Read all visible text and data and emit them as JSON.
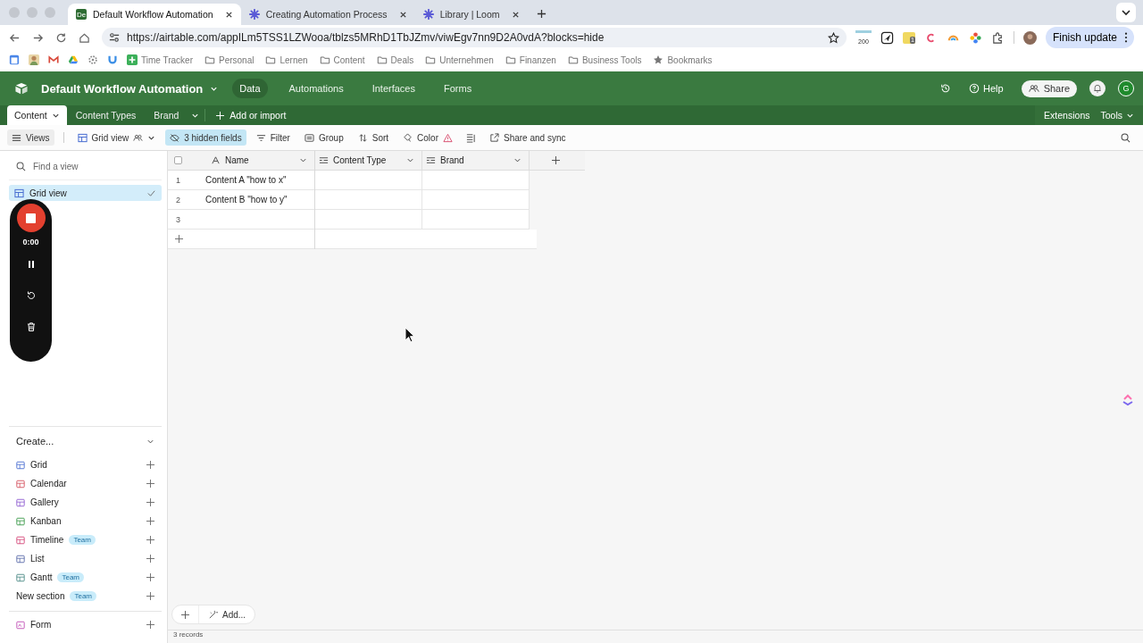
{
  "browser": {
    "tabs": [
      {
        "title": "Default Workflow Automation",
        "icon": "De",
        "selected": true
      },
      {
        "title": "Creating Automation Process",
        "selected": false
      },
      {
        "title": "Library | Loom",
        "selected": false
      }
    ],
    "url": "https://airtable.com/appILm5TSS1LZWooa/tblzs5MRhD1TbJZmv/viwEgv7nn9D2A0vdA?blocks=hide",
    "extension_count": "200",
    "extension_badge": "1",
    "update_button": "Finish update",
    "bookmarks": [
      {
        "label": "Time Tracker",
        "kind": "app"
      },
      {
        "label": "Personal",
        "kind": "folder"
      },
      {
        "label": "Lernen",
        "kind": "folder"
      },
      {
        "label": "Content",
        "kind": "folder"
      },
      {
        "label": "Deals",
        "kind": "folder"
      },
      {
        "label": "Unternehmen",
        "kind": "folder"
      },
      {
        "label": "Finanzen",
        "kind": "folder"
      },
      {
        "label": "Business Tools",
        "kind": "folder"
      },
      {
        "label": "Bookmarks",
        "kind": "star"
      }
    ]
  },
  "app": {
    "base_title": "Default Workflow Automation",
    "nav": [
      {
        "label": "Data",
        "selected": true
      },
      {
        "label": "Automations",
        "selected": false
      },
      {
        "label": "Interfaces",
        "selected": false
      },
      {
        "label": "Forms",
        "selected": false
      }
    ],
    "help": "Help",
    "share": "Share",
    "avatar": "G",
    "tables": [
      {
        "label": "Content",
        "selected": true
      },
      {
        "label": "Content Types",
        "selected": false
      },
      {
        "label": "Brand",
        "selected": false
      }
    ],
    "add_import": "Add or import",
    "extensions": "Extensions",
    "tools": "Tools",
    "toolbar": {
      "views": "Views",
      "view_name": "Grid view",
      "hidden_fields": "3 hidden fields",
      "filter": "Filter",
      "group": "Group",
      "sort": "Sort",
      "color_label": "Color",
      "share_sync": "Share and sync"
    },
    "sidebar": {
      "search_placeholder": "Find a view",
      "views": [
        {
          "name": "Grid view",
          "selected": true
        }
      ],
      "create_title": "Create...",
      "create_items": [
        {
          "label": "Grid",
          "kind": "grid"
        },
        {
          "label": "Calendar",
          "kind": "calendar"
        },
        {
          "label": "Gallery",
          "kind": "gallery"
        },
        {
          "label": "Kanban",
          "kind": "kanban"
        },
        {
          "label": "Timeline",
          "kind": "timeline",
          "badge": "Team"
        },
        {
          "label": "List",
          "kind": "list"
        },
        {
          "label": "Gantt",
          "kind": "gantt",
          "badge": "Team"
        },
        {
          "label": "New section",
          "kind": "section",
          "badge": "Team"
        }
      ],
      "form_item": {
        "label": "Form",
        "kind": "form"
      }
    },
    "grid": {
      "all_selected": false,
      "columns": [
        {
          "name": "Name",
          "kind": "text"
        },
        {
          "name": "Content Type",
          "kind": "select"
        },
        {
          "name": "Brand",
          "kind": "select"
        }
      ],
      "rows": [
        {
          "number": "1",
          "name": "Content A \"how to x\""
        },
        {
          "number": "2",
          "name": "Content B \"how to y\""
        },
        {
          "number": "3",
          "name": ""
        }
      ],
      "add_label": "Add...",
      "record_count": "3 records"
    }
  },
  "recorder": {
    "time": "0:00"
  }
}
